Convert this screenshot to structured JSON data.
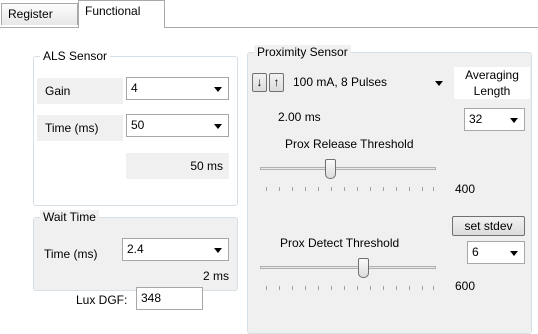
{
  "tabs": [
    "Register",
    "Functional"
  ],
  "als": {
    "title": "ALS Sensor",
    "gain_label": "Gain",
    "gain_value": "4",
    "time_label": "Time (ms)",
    "time_value": "50",
    "time_readout": "50 ms"
  },
  "wait": {
    "title": "Wait Time",
    "time_label": "Time (ms)",
    "time_value": "2.4",
    "time_readout": "2 ms"
  },
  "lux": {
    "label": "Lux DGF:",
    "value": "348"
  },
  "prox": {
    "title": "Proximity Sensor",
    "down_arrow": "↓",
    "up_arrow": "↑",
    "drive_value": "100 mA, 8 Pulses",
    "time_readout": "2.00 ms",
    "averaging_label": "Averaging\nLength",
    "averaging_value": "32",
    "release_label": "Prox Release Threshold",
    "release_value": "400",
    "set_stdev_label": "set stdev",
    "stdev_value": "6",
    "detect_label": "Prox Detect Threshold",
    "detect_value": "600"
  }
}
